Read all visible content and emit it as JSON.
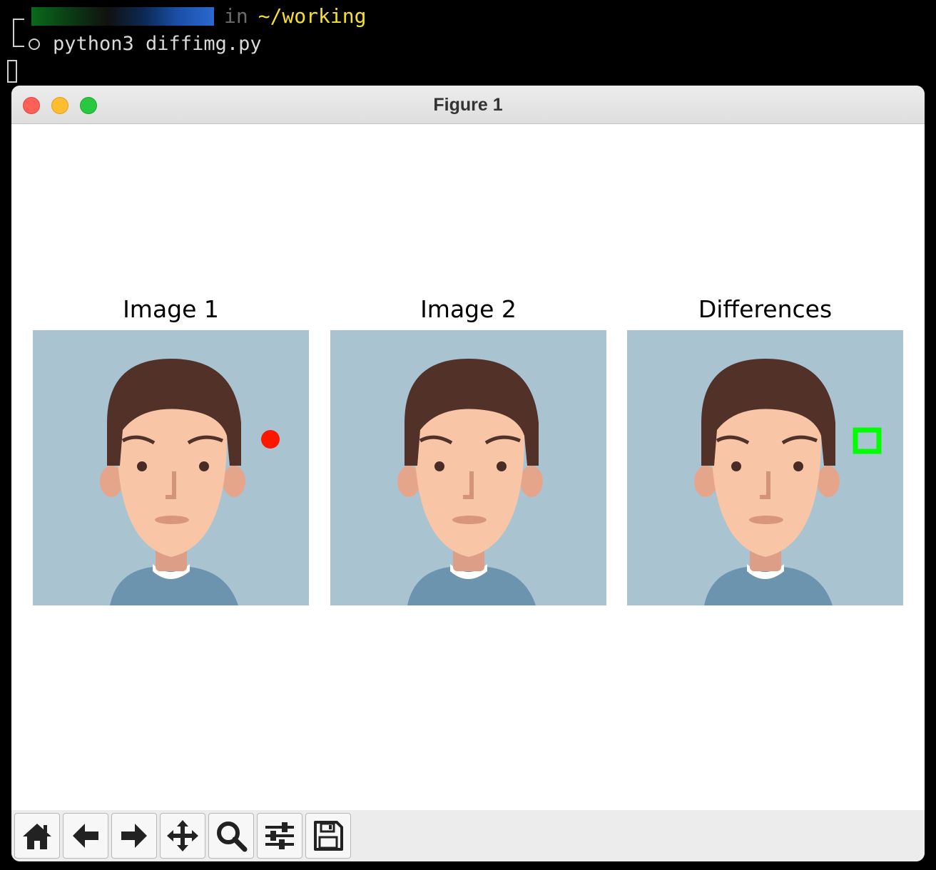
{
  "terminal": {
    "in_word": "in",
    "directory": "~/working",
    "command": "python3 diffimg.py"
  },
  "window": {
    "title": "Figure 1"
  },
  "figure": {
    "subplots": [
      {
        "title": "Image 1"
      },
      {
        "title": "Image 2"
      },
      {
        "title": "Differences"
      }
    ]
  },
  "toolbar": {
    "buttons": [
      {
        "icon": "home-icon",
        "action": "home"
      },
      {
        "icon": "back-arrow-icon",
        "action": "back"
      },
      {
        "icon": "forward-arrow-icon",
        "action": "forward"
      },
      {
        "icon": "pan-move-icon",
        "action": "pan"
      },
      {
        "icon": "zoom-magnifier-icon",
        "action": "zoom"
      },
      {
        "icon": "configure-subplots-icon",
        "action": "subplots"
      },
      {
        "icon": "save-disk-icon",
        "action": "save"
      }
    ]
  },
  "colors": {
    "image_bg": "#a9c3d0",
    "hair": "#523128",
    "skin": "#f8c6a6",
    "shirt": "#6d94ae",
    "red_dot": "#fb1800",
    "diff_box": "#00ff00",
    "dir_yellow": "#f5e12c"
  }
}
